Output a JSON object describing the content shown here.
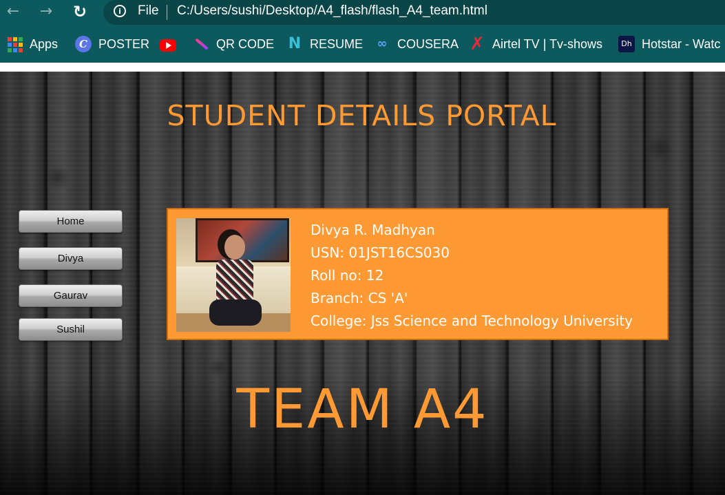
{
  "browser": {
    "info_icon": "info-icon",
    "file_label": "File",
    "url": "C:/Users/sushi/Desktop/A4_flash/flash_A4_team.html"
  },
  "bookmarks": [
    {
      "label": "Apps",
      "icon": "apps-grid-icon"
    },
    {
      "label": "POSTER",
      "icon": "canva-icon"
    },
    {
      "label": "",
      "icon": "youtube-icon"
    },
    {
      "label": "QR CODE",
      "icon": "qr-code-pen-icon"
    },
    {
      "label": "RESUME",
      "icon": "notion-n-icon"
    },
    {
      "label": "COUSERA",
      "icon": "coursera-icon"
    },
    {
      "label": "Airtel TV | Tv-shows",
      "icon": "airtel-icon"
    },
    {
      "label": "Hotstar - Watc",
      "icon": "hotstar-icon"
    }
  ],
  "page": {
    "title": "STUDENT DETAILS PORTAL",
    "menu": [
      "Home",
      "Divya",
      "Gaurav",
      "Sushil"
    ],
    "card": {
      "name": "Divya R. Madhyan",
      "usn": "USN: 01JST16CS030",
      "roll": "Roll no: 12",
      "branch": "Branch: CS 'A'",
      "college": "College: Jss Science and Technology University"
    },
    "team": "TEAM A4"
  },
  "colors": {
    "accent": "#ff9933",
    "chrome": "#0d5a5e"
  }
}
